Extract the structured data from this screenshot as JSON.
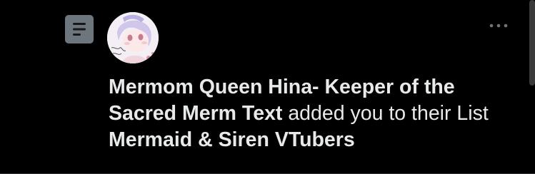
{
  "notification": {
    "type_icon": "list-icon",
    "more_icon": "more-horizontal-icon",
    "avatar_icon": "anime-avatar-icon",
    "user_name": "Mermom Queen Hina- Keeper of the Sacred Merm Text",
    "action_text": "added you to their List",
    "list_name": "Mermaid & Siren VTubers"
  },
  "colors": {
    "background": "#000000",
    "text": "#e7e9ea",
    "icon_bg": "#6e767d",
    "muted": "#6e767d"
  }
}
